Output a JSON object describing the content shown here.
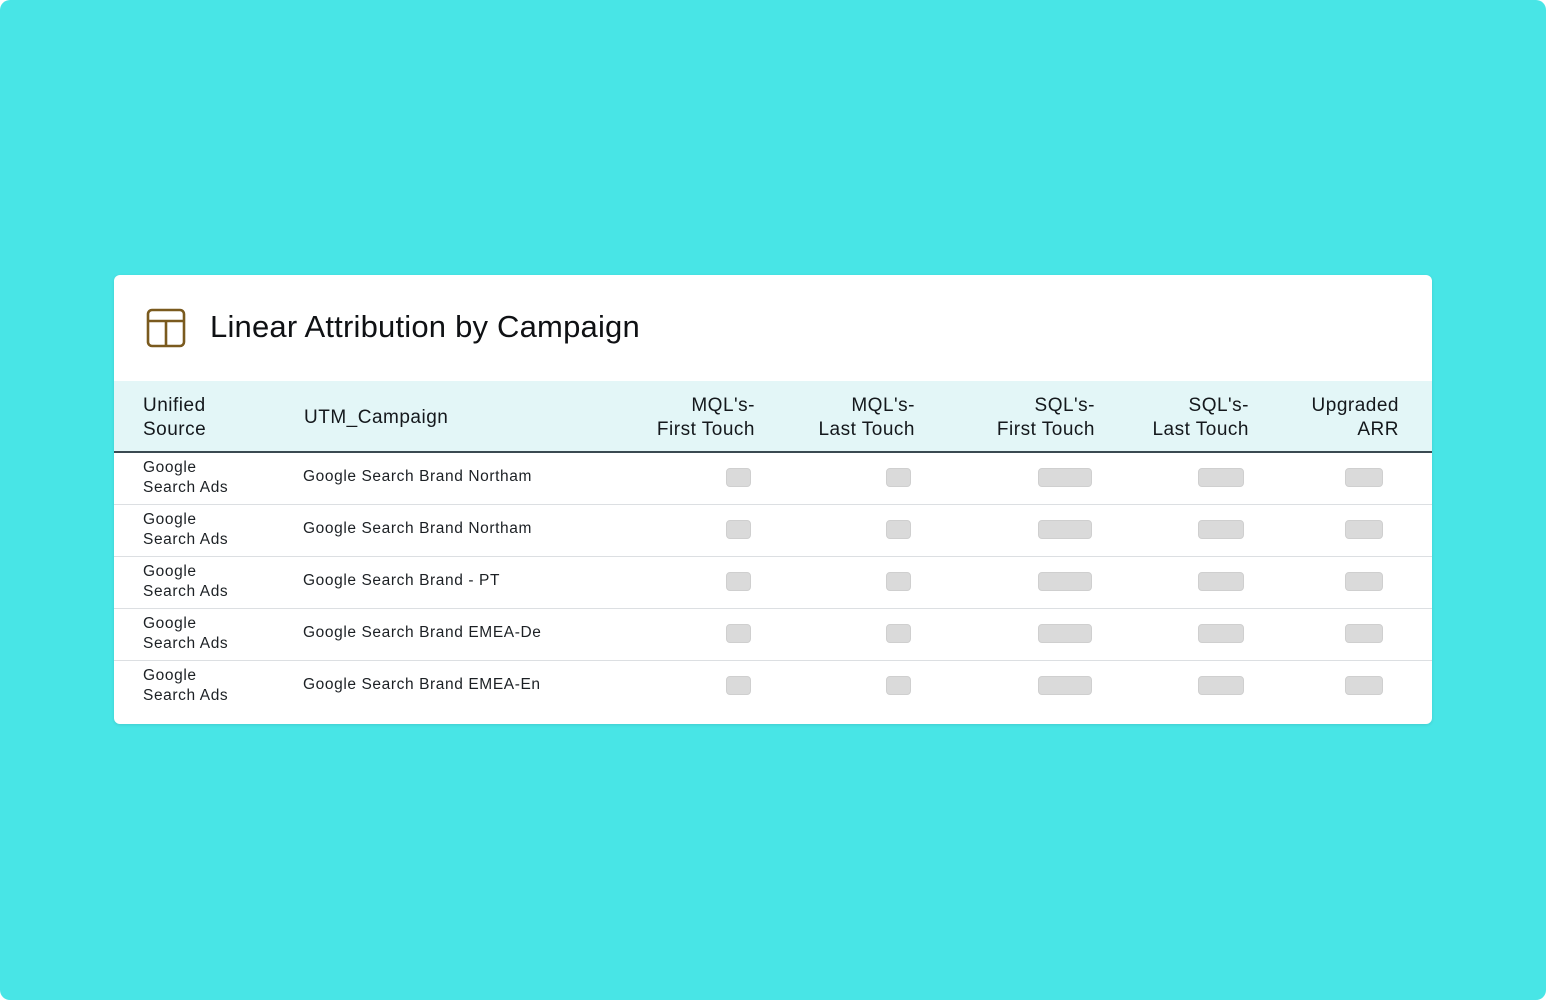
{
  "card": {
    "title": "Linear Attribution by Campaign",
    "icon": "table-icon",
    "icon_color": "#7a5a1e"
  },
  "colors": {
    "background": "#48e5e6",
    "header_row": "#e3f6f7",
    "placeholder": "#dadada"
  },
  "table": {
    "headers": {
      "source": [
        "Unified",
        "Source"
      ],
      "campaign": "UTM_Campaign",
      "mql_first": [
        "MQL's-",
        "First Touch"
      ],
      "mql_last": [
        "MQL's-",
        "Last Touch"
      ],
      "sql_first": [
        "SQL's-",
        "First Touch"
      ],
      "sql_last": [
        "SQL's-",
        "Last Touch"
      ],
      "arr": [
        "Upgraded",
        "ARR"
      ]
    },
    "rows": [
      {
        "source": [
          "Google",
          "Search Ads"
        ],
        "campaign": "Google Search Brand Northam"
      },
      {
        "source": [
          "Google",
          "Search Ads"
        ],
        "campaign": "Google Search Brand Northam"
      },
      {
        "source": [
          "Google",
          "Search Ads"
        ],
        "campaign": "Google Search Brand - PT"
      },
      {
        "source": [
          "Google",
          "Search Ads"
        ],
        "campaign": "Google Search Brand EMEA-De"
      },
      {
        "source": [
          "Google",
          "Search Ads"
        ],
        "campaign": "Google Search Brand EMEA-En"
      }
    ]
  }
}
